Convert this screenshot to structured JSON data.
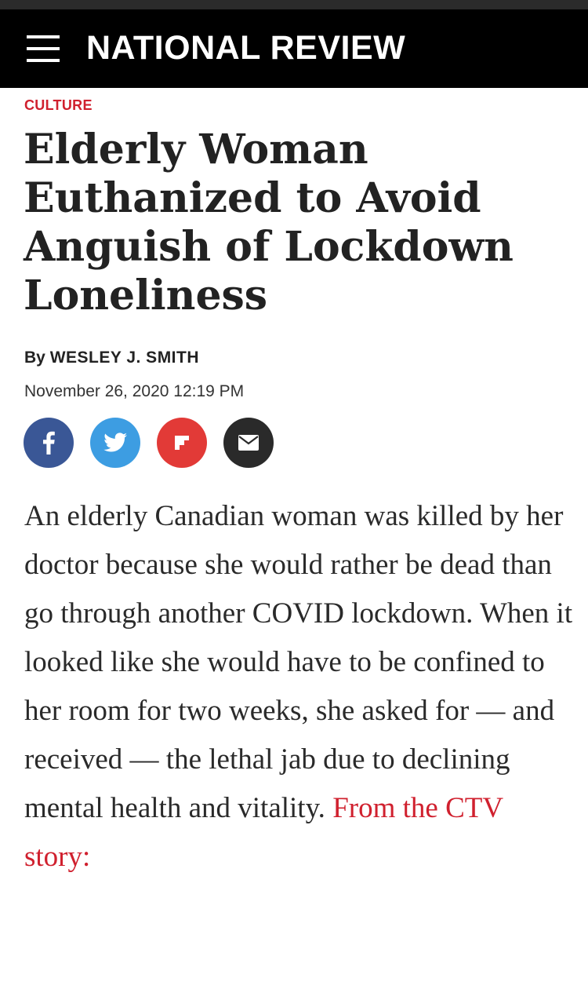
{
  "header": {
    "logo": "NATIONAL REVIEW",
    "menu_icon": "hamburger-menu-icon",
    "background": "#000000"
  },
  "article": {
    "category": "CULTURE",
    "headline": "Elderly Woman Euthanized to Avoid Anguish of Lockdown Loneliness",
    "byline_prefix": "By",
    "author": "WESLEY J. SMITH",
    "date": "November 26, 2020 12:19 PM",
    "body": "An elderly Canadian woman was killed by her doctor because she would rather be dead than go through another COVID lockdown. When it looked like she would have to be confined to her room for two weeks, she asked for — and received — the lethal jab due to declining mental health and vitality. ",
    "link_text": "From the CTV story:"
  },
  "share": [
    {
      "name": "facebook",
      "icon": "facebook-icon",
      "color": "#3a5796"
    },
    {
      "name": "twitter",
      "icon": "twitter-icon",
      "color": "#3d9de2"
    },
    {
      "name": "flipboard",
      "icon": "flipboard-icon",
      "color": "#e23a37"
    },
    {
      "name": "email",
      "icon": "email-icon",
      "color": "#2a2a2a"
    }
  ],
  "colors": {
    "accent": "#d0202e",
    "text": "#222222"
  }
}
